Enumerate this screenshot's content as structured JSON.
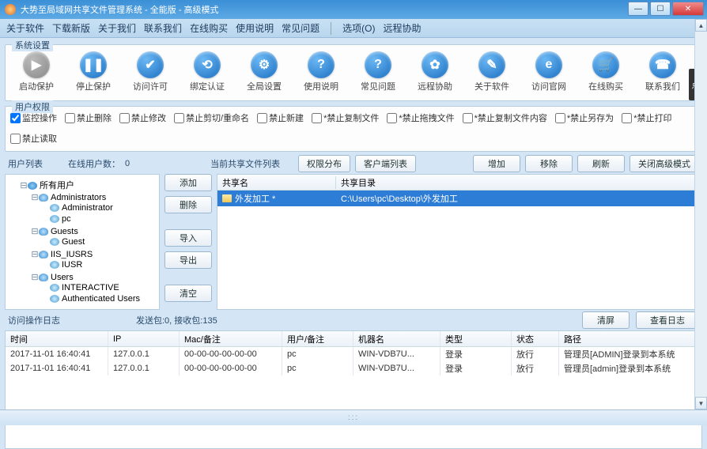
{
  "title": "大势至局域网共享文件管理系统           - 全能版 - 高级模式",
  "menu": [
    "关于软件",
    "下载新版",
    "关于我们",
    "联系我们",
    "在线购买",
    "使用说明",
    "常见问题",
    "选项(O)",
    "远程协助"
  ],
  "toolbar_group": "系统设置",
  "toolbar": [
    {
      "label": "启动保护",
      "glyph": "▶",
      "cls": "gray"
    },
    {
      "label": "停止保护",
      "glyph": "❚❚"
    },
    {
      "label": "访问许可",
      "glyph": "✔"
    },
    {
      "label": "绑定认证",
      "glyph": "⟲"
    },
    {
      "label": "全局设置",
      "glyph": "⚙"
    },
    {
      "label": "使用说明",
      "glyph": "?"
    },
    {
      "label": "常见问题",
      "glyph": "?"
    },
    {
      "label": "远程协助",
      "glyph": "✿"
    },
    {
      "label": "关于软件",
      "glyph": "✎"
    },
    {
      "label": "访问官网",
      "glyph": "e"
    },
    {
      "label": "在线购买",
      "glyph": "🛒"
    },
    {
      "label": "联系我们",
      "glyph": "☎"
    }
  ],
  "perm_group": "用户权限",
  "perms": [
    {
      "label": "监控操作",
      "checked": true
    },
    {
      "label": "禁止删除"
    },
    {
      "label": "禁止修改"
    },
    {
      "label": "禁止剪切/重命名"
    },
    {
      "label": "禁止新建"
    },
    {
      "label": "*禁止复制文件"
    },
    {
      "label": "*禁止拖拽文件"
    },
    {
      "label": "*禁止复制文件内容"
    },
    {
      "label": "*禁止另存为"
    },
    {
      "label": "*禁止打印"
    },
    {
      "label": "禁止读取"
    }
  ],
  "labels": {
    "userlist": "用户列表",
    "online": "在线用户数：",
    "online_count": "0",
    "sharelist": "当前共享文件列表",
    "sendrecv": "发送包:0, 接收包:135",
    "loglabel": "访问操作日志"
  },
  "btns": {
    "perm_dist": "权限分布",
    "client_list": "客户端列表",
    "add2": "增加",
    "remove": "移除",
    "refresh": "刷新",
    "close_adv": "关闭高级模式",
    "add": "添加",
    "del": "删除",
    "import": "导入",
    "export": "导出",
    "clear": "清空",
    "clear_log": "清屏",
    "view_log": "查看日志"
  },
  "tree": {
    "root": "所有用户",
    "groups": [
      {
        "name": "Administrators",
        "children": [
          "Administrator",
          "pc"
        ]
      },
      {
        "name": "Guests",
        "children": [
          "Guest"
        ]
      },
      {
        "name": "IIS_IUSRS",
        "children": [
          "IUSR"
        ]
      },
      {
        "name": "Users",
        "children": [
          "INTERACTIVE",
          "Authenticated Users"
        ]
      }
    ]
  },
  "share_header": {
    "name": "共享名",
    "dir": "共享目录"
  },
  "shares": [
    {
      "name": "外发加工 *",
      "dir": "C:\\Users\\pc\\Desktop\\外发加工"
    }
  ],
  "log_header": {
    "time": "时间",
    "ip": "IP",
    "mac": "Mac/备注",
    "user": "用户/备注",
    "host": "机器名",
    "type": "类型",
    "state": "状态",
    "path": "路径"
  },
  "logs": [
    {
      "time": "2017-11-01 16:40:41",
      "ip": "127.0.0.1",
      "mac": "00-00-00-00-00-00",
      "user": "pc",
      "host": "WIN-VDB7U...",
      "type": "登录",
      "state": "放行",
      "path": "管理员[ADMIN]登录到本系统"
    },
    {
      "time": "2017-11-01 16:40:41",
      "ip": "127.0.0.1",
      "mac": "00-00-00-00-00-00",
      "user": "pc",
      "host": "WIN-VDB7U...",
      "type": "登录",
      "state": "放行",
      "path": "管理员[admin]登录到本系统"
    }
  ],
  "morebtn": "点"
}
